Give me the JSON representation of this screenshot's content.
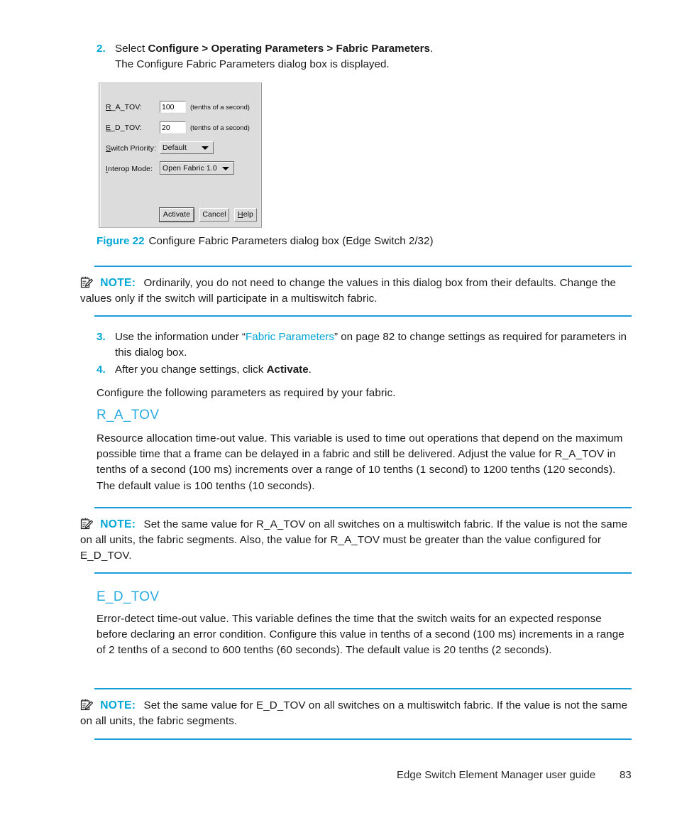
{
  "footer": {
    "title": "Edge Switch Element Manager user guide",
    "page": "83"
  },
  "steps": [
    {
      "number": "2.",
      "line1_prefix": "Select ",
      "line1_bold": "Configure > Operating Parameters > Fabric Parameters",
      "line1_suffix": ".",
      "line2": "The Configure Fabric Parameters dialog box is displayed."
    },
    {
      "number": "3.",
      "part1": "Use the information under “",
      "link": "Fabric Parameters",
      "part2": "” on page 82 to change settings as required for parameters in this dialog box."
    },
    {
      "number": "4.",
      "part1": "After you change settings, click ",
      "bold": "Activate",
      "part2": "."
    }
  ],
  "intro_paragraph": "Configure the following parameters as required by your fabric.",
  "figure": {
    "label": "Figure 22",
    "caption": "Configure Fabric Parameters dialog box (Edge Switch 2/32)"
  },
  "dialog": {
    "fields": [
      {
        "label_mnemonic": "R",
        "label_rest": "_A_TOV:",
        "value": "100",
        "hint": "(tenths of a second)"
      },
      {
        "label_mnemonic": "E",
        "label_rest": "_D_TOV:",
        "value": "20",
        "hint": "(tenths of a second)"
      }
    ],
    "combos": [
      {
        "label_mnemonic": "S",
        "label_rest": "witch Priority:",
        "value": "Default"
      },
      {
        "label_mnemonic": "I",
        "label_rest": "nterop Mode:",
        "value": "Open Fabric 1.0"
      }
    ],
    "buttons": [
      {
        "label": "Activate",
        "mnemonic": "",
        "default": true
      },
      {
        "label": "Cancel",
        "mnemonic": "",
        "default": false
      },
      {
        "label_pre": "",
        "mnemonic": "H",
        "label_post": "elp",
        "default": false
      }
    ]
  },
  "notes": [
    {
      "icon": "note-pencil-icon",
      "label": "NOTE:",
      "text": "Ordinarily, you do not need to change the values in this dialog box from their defaults. Change the values only if the switch will participate in a multiswitch fabric."
    },
    {
      "icon": "note-pencil-icon",
      "label": "NOTE:",
      "text": "Set the same value for R_A_TOV on all switches on a multiswitch fabric. If the value is not the same on all units, the fabric segments. Also, the value for R_A_TOV must be greater than the value configured for E_D_TOV."
    },
    {
      "icon": "note-pencil-icon",
      "label": "NOTE:",
      "text": "Set the same value for E_D_TOV on all switches on a multiswitch fabric. If the value is not the same on all units, the fabric segments."
    }
  ],
  "sections": [
    {
      "heading": "R_A_TOV",
      "body": "Resource allocation time-out value. This variable is used to time out operations that depend on the maximum possible time that a frame can be delayed in a fabric and still be delivered. Adjust the value for R_A_TOV in tenths of a second (100 ms) increments over a range of 10 tenths (1 second) to 1200 tenths (120 seconds). The default value is 100 tenths (10 seconds)."
    },
    {
      "heading": "E_D_TOV",
      "body": "Error-detect time-out value. This variable defines the time that the switch waits for an expected response before declaring an error condition. Configure this value in tenths of a second (100 ms) increments in a range of 2 tenths of a second to 600 tenths (60 seconds). The default value is 20 tenths (2 seconds)."
    }
  ],
  "colors": {
    "accent_cyan": "#00a6d6",
    "heading_cyan": "#29abe2",
    "rule_cyan": "#1b9dd9",
    "dialog_face": "#dcdcdc"
  }
}
